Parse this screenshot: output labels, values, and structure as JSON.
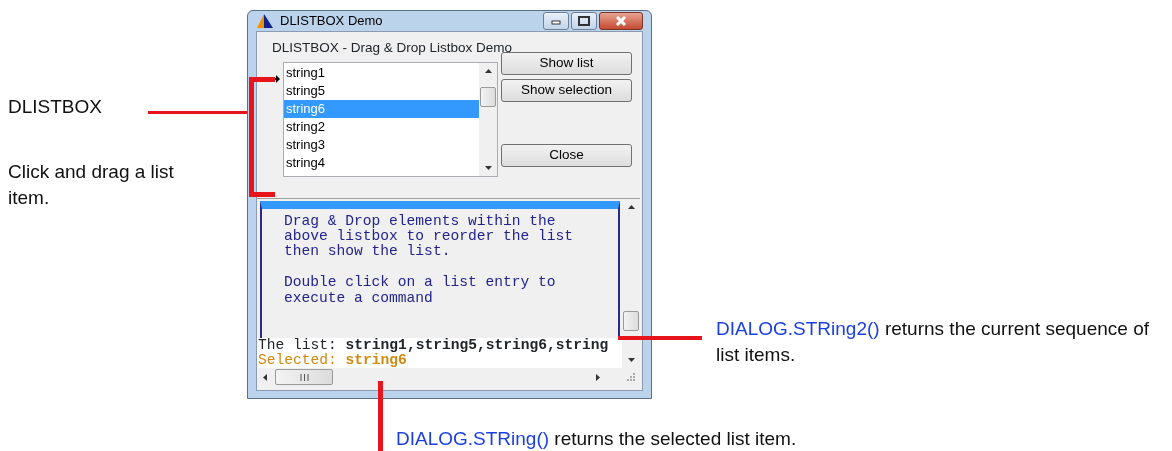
{
  "callouts_left": [
    {
      "text": "DLISTBOX"
    },
    {
      "text": "Click and drag a list item."
    }
  ],
  "window": {
    "title": "DLISTBOX Demo",
    "heading": "DLISTBOX - Drag & Drop Listbox Demo",
    "list_items": [
      {
        "label": "string1",
        "selected": false
      },
      {
        "label": "string5",
        "selected": false
      },
      {
        "label": "string6",
        "selected": true
      },
      {
        "label": "string2",
        "selected": false
      },
      {
        "label": "string3",
        "selected": false
      },
      {
        "label": "string4",
        "selected": false
      }
    ],
    "buttons": [
      {
        "label": "Show list"
      },
      {
        "label": "Show selection"
      },
      {
        "label": "Close"
      }
    ],
    "info_paragraphs": [
      [
        "Drag & Drop elements within the",
        "above listbox to reorder the list",
        "then show the list."
      ],
      [
        "Double click on a list entry to",
        "execute a command"
      ]
    ],
    "list_line": {
      "label": "The list:",
      "value": "string1,string5,string6,string"
    },
    "selected_line": {
      "label": "Selected:",
      "value": "string6"
    }
  },
  "callouts": [
    {
      "code": "DIALOG.STRing2()",
      "text": "returns the current sequence of list items."
    },
    {
      "code": "DIALOG.STRing()",
      "text": "returns the selected list item."
    }
  ]
}
